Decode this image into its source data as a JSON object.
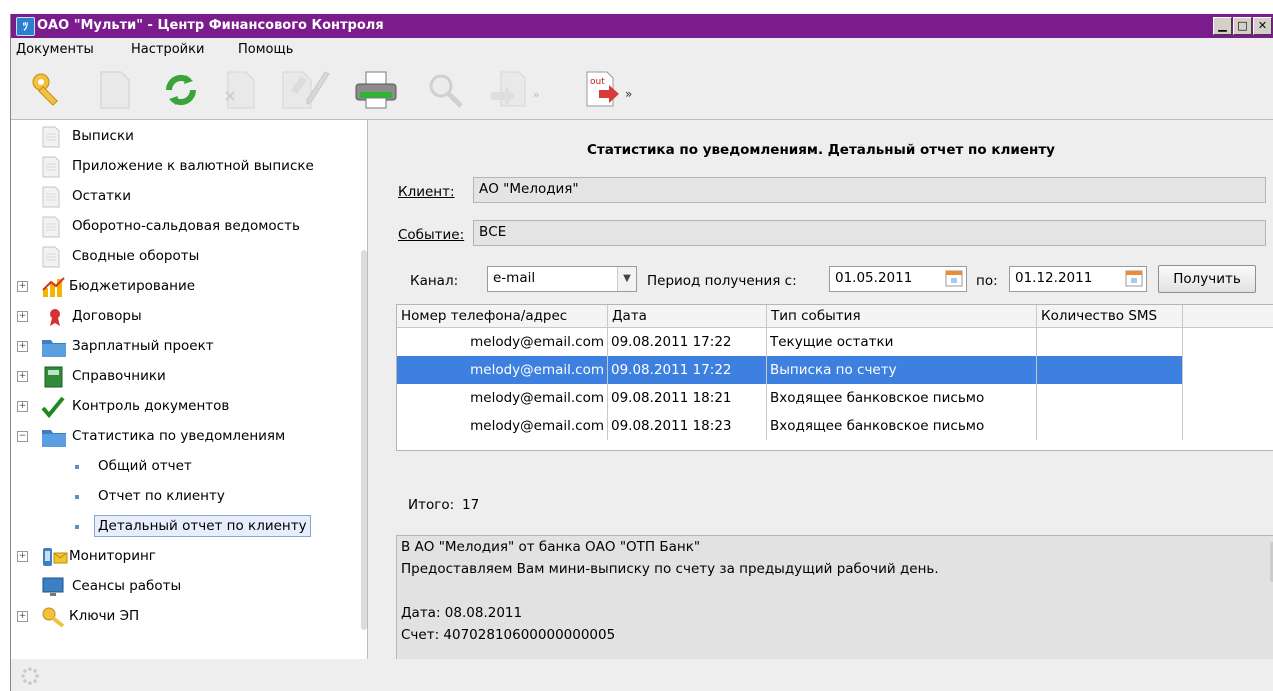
{
  "window": {
    "title": "ОАО \"Мульти\" - Центр Финансового Контроля",
    "app_icon": "app-icon"
  },
  "window_buttons": {
    "minimize": "▁",
    "maximize": "□",
    "close": "✕"
  },
  "menu": [
    "Документы",
    "Настройки",
    "Помощь"
  ],
  "toolbar": [
    "keys-icon",
    "document-icon",
    "refresh-icon",
    "delete-icon",
    "sign-icon",
    "pen-icon",
    "printer-icon",
    "search-icon",
    "export-icon",
    "out-icon"
  ],
  "tree": {
    "items": [
      {
        "label": "Выписки",
        "icon": "document-icon"
      },
      {
        "label": "Приложение к валютной выписке",
        "icon": "document-icon"
      },
      {
        "label": "Остатки",
        "icon": "document-icon"
      },
      {
        "label": "Оборотно-сальдовая ведомость",
        "icon": "document-icon"
      },
      {
        "label": "Сводные обороты",
        "icon": "document-icon"
      },
      {
        "label": "Бюджетирование",
        "icon": "chart-icon"
      },
      {
        "label": "Договоры",
        "icon": "seal-icon"
      },
      {
        "label": "Зарплатный проект",
        "icon": "folder-icon"
      },
      {
        "label": "Справочники",
        "icon": "book-icon"
      },
      {
        "label": "Контроль документов",
        "icon": "checkmark-icon"
      },
      {
        "label": "Статистика по уведомлениям",
        "icon": "folder-icon"
      },
      {
        "label": "Общий отчет",
        "icon": "bullet-icon"
      },
      {
        "label": "Отчет по клиенту",
        "icon": "bullet-icon"
      },
      {
        "label": "Детальный отчет по клиенту",
        "icon": "bullet-icon"
      },
      {
        "label": "Мониторинг",
        "icon": "monitoring-icon"
      },
      {
        "label": "Сеансы работы",
        "icon": "monitor-icon"
      },
      {
        "label": "Ключи ЭП",
        "icon": "key-icon"
      }
    ]
  },
  "report": {
    "title": "Статистика по уведомлениям. Детальный отчет по клиенту",
    "client_label": "Клиент:",
    "client_value": "АО \"Мелодия\"",
    "event_label": "Событие:",
    "event_value": "ВСЕ",
    "channel_label": "Канал:",
    "channel_value": "e-mail",
    "period_from_label": "Период получения с:",
    "period_from": "01.05.2011",
    "period_to_label": "по:",
    "period_to": "01.12.2011",
    "get_button": "Получить",
    "table": {
      "columns": [
        "Номер телефона/адрес",
        "Дата",
        "Тип события",
        "Количество SMS"
      ],
      "rows": [
        [
          "melody@email.com",
          "09.08.2011 17:22",
          "Текущие остатки",
          ""
        ],
        [
          "melody@email.com",
          "09.08.2011 17:22",
          "Выписка по счету",
          ""
        ],
        [
          "melody@email.com",
          "09.08.2011 18:21",
          "Входящее банковское письмо",
          ""
        ],
        [
          "melody@email.com",
          "09.08.2011 18:23",
          "Входящее банковское письмо",
          ""
        ]
      ]
    },
    "total_label": "Итого:",
    "total_value": "17",
    "message_lines": [
      "В АО \"Мелодия\" от банка ОАО \"ОТП Банк\"",
      "Предоставляем Вам мини-выписку по счету за предыдущий рабочий день.",
      "",
      "Дата: 08.08.2011",
      "Счет: 40702810600000000005"
    ]
  },
  "colors": {
    "titlebar": "#7a1c8c",
    "selection": "#3d80df"
  }
}
